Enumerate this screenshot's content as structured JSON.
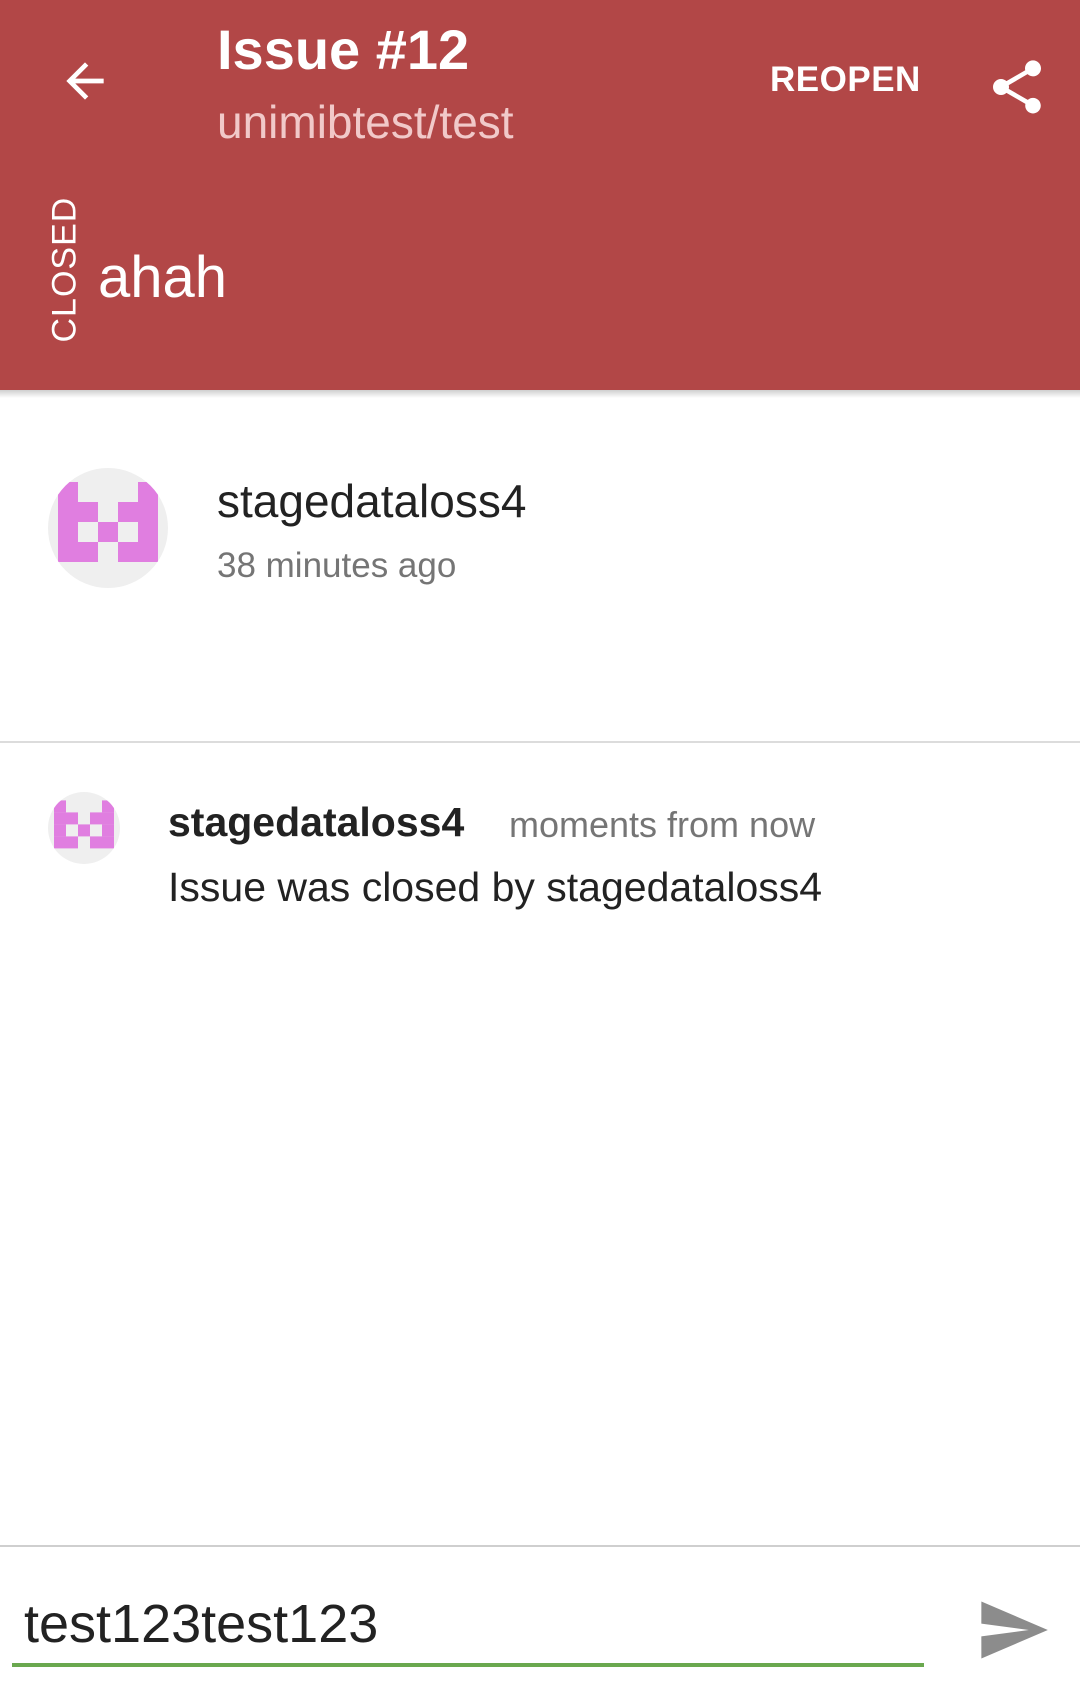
{
  "header": {
    "title": "Issue #12",
    "subtitle": "unimibtest/test",
    "reopen_label": "REOPEN",
    "state": "CLOSED",
    "issue_title": "ahah",
    "background_color": "#b24747"
  },
  "icons": {
    "back": "arrow-back-icon",
    "share": "share-icon",
    "send": "send-icon"
  },
  "issue": {
    "author": "stagedataloss4",
    "created": "38 minutes ago",
    "avatar_color": "#e07ee0"
  },
  "events": [
    {
      "user": "stagedataloss4",
      "time": "moments from now",
      "text": "Issue was closed by stagedataloss4"
    }
  ],
  "comment_box": {
    "value": "test123test123",
    "underline_color": "#6aa84f"
  }
}
